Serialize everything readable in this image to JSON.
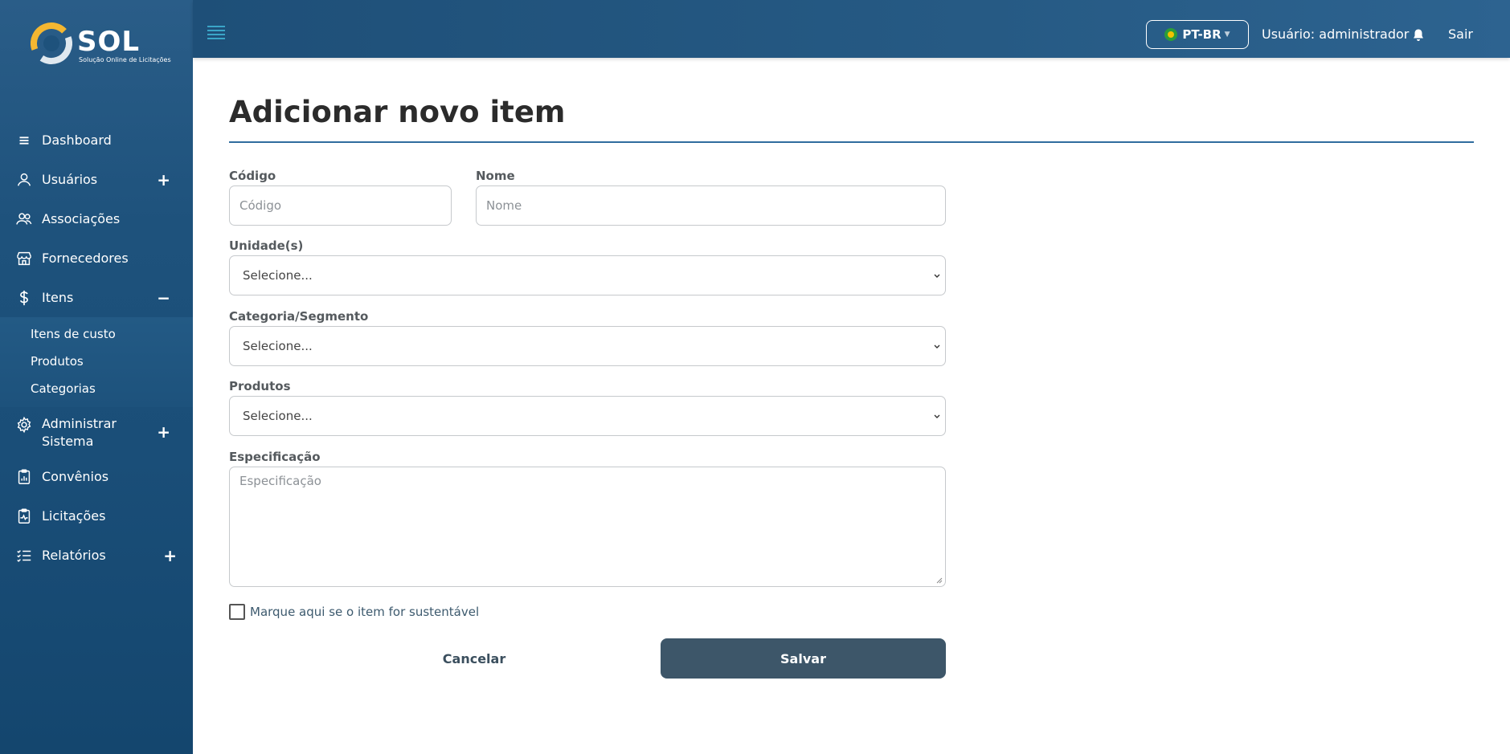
{
  "brand": {
    "name": "SOL",
    "tagline": "Solução Online de Licitações"
  },
  "sidebar": {
    "items": [
      {
        "label": "Dashboard",
        "icon": "menu-lines-icon"
      },
      {
        "label": "Usuários",
        "icon": "user-icon",
        "toggle": "+"
      },
      {
        "label": "Associações",
        "icon": "users-icon"
      },
      {
        "label": "Fornecedores",
        "icon": "store-icon"
      },
      {
        "label": "Itens",
        "icon": "dollar-icon",
        "toggle": "−"
      },
      {
        "label": "Administrar Sistema",
        "icon": "gear-icon",
        "toggle": "+"
      },
      {
        "label": "Convênios",
        "icon": "clipboard-chart-icon"
      },
      {
        "label": "Licitações",
        "icon": "clipboard-pulse-icon"
      },
      {
        "label": "Relatórios",
        "icon": "list-check-icon",
        "toggle": "+"
      }
    ],
    "subitems": [
      {
        "label": "Itens de custo"
      },
      {
        "label": "Produtos"
      },
      {
        "label": "Categorias"
      }
    ]
  },
  "topbar": {
    "language": "PT-BR",
    "user_label": "Usuário: administrador",
    "logout": "Sair"
  },
  "form": {
    "title": "Adicionar novo item",
    "codigo": {
      "label": "Código",
      "placeholder": "Código"
    },
    "nome": {
      "label": "Nome",
      "placeholder": "Nome"
    },
    "unidades": {
      "label": "Unidade(s)",
      "value": "Selecione..."
    },
    "categoria": {
      "label": "Categoria/Segmento",
      "value": "Selecione..."
    },
    "produtos": {
      "label": "Produtos",
      "value": "Selecione..."
    },
    "especificacao": {
      "label": "Especificação",
      "placeholder": "Especificação"
    },
    "sustentavel_label": "Marque aqui se o item for sustentável",
    "cancel_label": "Cancelar",
    "save_label": "Salvar"
  },
  "colors": {
    "sidebar": "#1e527c",
    "topbar": "#265a84",
    "save_button": "#3d5669",
    "title_rule": "#2f6c9e"
  }
}
